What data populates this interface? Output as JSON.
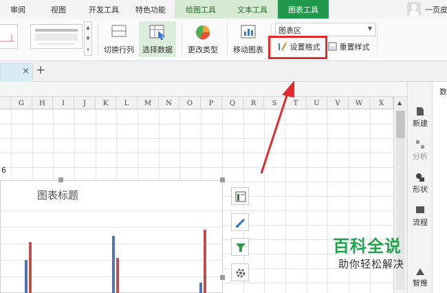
{
  "menu": {
    "tabs": [
      "审阅",
      "视图",
      "开发工具",
      "特色功能",
      "绘图工具",
      "文本工具",
      "图表工具"
    ],
    "active_tab": "图表工具",
    "user_label": "一页皮"
  },
  "ribbon": {
    "switch_row_col": "切换行列",
    "select_data": "选择数据",
    "change_type": "更改类型",
    "move_chart": "移动图表",
    "chart_area_value": "图表区",
    "set_format": "设置格式",
    "reset_style": "重置样式"
  },
  "doc": {
    "close_glyph": "×",
    "new_tab_glyph": "+"
  },
  "sheet": {
    "columns": [
      "G",
      "H",
      "I",
      "J",
      "K",
      "L",
      "M",
      "N",
      "O",
      "P",
      "Q",
      "R",
      "S",
      "T",
      "U",
      "V",
      "W",
      "X"
    ],
    "cell_value": "6"
  },
  "chart": {
    "title": "图表标题",
    "groups": [
      {
        "blue": 0.3,
        "red": 0.46
      },
      {
        "blue": 0.51,
        "red": 0.32
      },
      {
        "blue": 0.1,
        "red": 0.57
      }
    ]
  },
  "side_panel": {
    "items": [
      "新建",
      "分析",
      "形状",
      "流程",
      "智推"
    ],
    "pane_label": "数"
  },
  "watermark": {
    "title": "百科全说",
    "subtitle": "助你轻松解决"
  },
  "colors": {
    "accent": "#1f9a4a",
    "highlight": "#e12a2a",
    "bar_blue": "#4e73b8",
    "bar_red": "#c0504d"
  }
}
